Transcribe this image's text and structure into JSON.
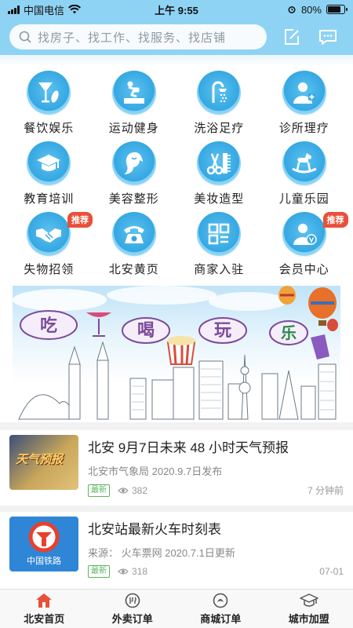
{
  "status_bar": {
    "carrier": "中国电信",
    "time": "上午 9:55",
    "battery": "80%",
    "battery_level": 0.8
  },
  "header": {
    "search_placeholder": "找房子、找工作、找服务、找店铺",
    "edit_icon": "edit-icon",
    "message_icon": "message-icon"
  },
  "categories": [
    {
      "label": "餐饮娱乐",
      "icon": "dining-icon",
      "tag": ""
    },
    {
      "label": "运动健身",
      "icon": "fitness-icon",
      "tag": ""
    },
    {
      "label": "洗浴足疗",
      "icon": "shower-icon",
      "tag": ""
    },
    {
      "label": "诊所理疗",
      "icon": "clinic-icon",
      "tag": ""
    },
    {
      "label": "教育培训",
      "icon": "graduation-cap-icon",
      "tag": ""
    },
    {
      "label": "美容整形",
      "icon": "beauty-icon",
      "tag": ""
    },
    {
      "label": "美妆造型",
      "icon": "scissors-comb-icon",
      "tag": ""
    },
    {
      "label": "儿童乐园",
      "icon": "rocking-horse-icon",
      "tag": ""
    },
    {
      "label": "失物招领",
      "icon": "handshake-icon",
      "tag": "推荐"
    },
    {
      "label": "北安黄页",
      "icon": "telephone-icon",
      "tag": ""
    },
    {
      "label": "商家入驻",
      "icon": "merchant-grid-icon",
      "tag": ""
    },
    {
      "label": "会员中心",
      "icon": "member-icon",
      "tag": "推荐"
    }
  ],
  "banner": {
    "words": [
      "吃",
      "喝",
      "玩",
      "乐"
    ]
  },
  "news": [
    {
      "title": "北安 9月7日未来 48 小时天气预报",
      "source": "北安市气象局 2020.9.7日发布",
      "badge": "最新",
      "views": "382",
      "time": "7 分钟前",
      "thumb_text": "天气预报"
    },
    {
      "title": "北安站最新火车时刻表",
      "source": "来源：   火车票网 2020.7.1日更新",
      "badge": "最新",
      "views": "318",
      "time": "07-01",
      "thumb_text": "中国铁路"
    }
  ],
  "tabs": [
    {
      "label": "北安首页",
      "icon": "home-icon",
      "active": true
    },
    {
      "label": "外卖订单",
      "icon": "takeout-order-icon",
      "active": false
    },
    {
      "label": "商城订单",
      "icon": "mall-order-icon",
      "active": false
    },
    {
      "label": "城市加盟",
      "icon": "franchise-icon",
      "active": false
    }
  ],
  "colors": {
    "accent": "#35a7e2",
    "header": "#8fd3f4",
    "tag": "#e8503a",
    "badge": "#5db55d",
    "active_tab": "#e8503a"
  }
}
